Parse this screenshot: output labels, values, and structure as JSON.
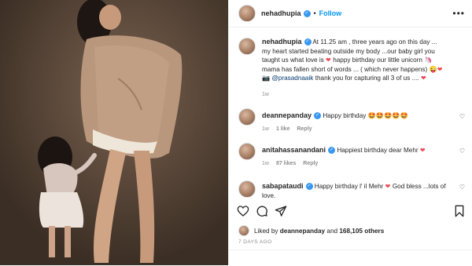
{
  "post": {
    "author": "nehadhupia",
    "follow_label": "Follow",
    "caption_prefix": "At 11.25 am , three years ago on this day ... my heart started beating outside my body ...our baby girl you taught us what love is",
    "caption_mid1": "happy birthday our little unicorn",
    "caption_mid2": "mama has fallen short of words ... ( which never happens)",
    "mention": "@prasadnaaik",
    "caption_suffix": "thank you for capturing all 3 of us ....",
    "caption_age": "1w"
  },
  "comments": [
    {
      "username": "deannepanday",
      "text": "Happy birthday",
      "emojis": "🤩🤩🤩🤩🤩",
      "age": "1w",
      "likes": "1 like",
      "reply": "Reply"
    },
    {
      "username": "anitahassanandani",
      "text": "Happiest birthday dear Mehr",
      "emojis": "❤",
      "age": "1w",
      "likes": "87 likes",
      "reply": "Reply"
    },
    {
      "username": "sabapataudi",
      "text_a": "Happy birthday l' il Mehr",
      "text_b": "God bless ...lots of love.",
      "emojis": "❤"
    }
  ],
  "likes": {
    "prefix": "Liked by",
    "user": "deannepanday",
    "joiner": "and",
    "count": "168,105 others"
  },
  "date": "7 DAYS AGO",
  "icons": [
    "more-icon",
    "verified-icon",
    "heart-icon",
    "comment-icon",
    "share-icon",
    "bookmark-icon"
  ],
  "colors": {
    "accent": "#0095f6",
    "verified": "#3897f0",
    "heart": "#ed4956"
  }
}
